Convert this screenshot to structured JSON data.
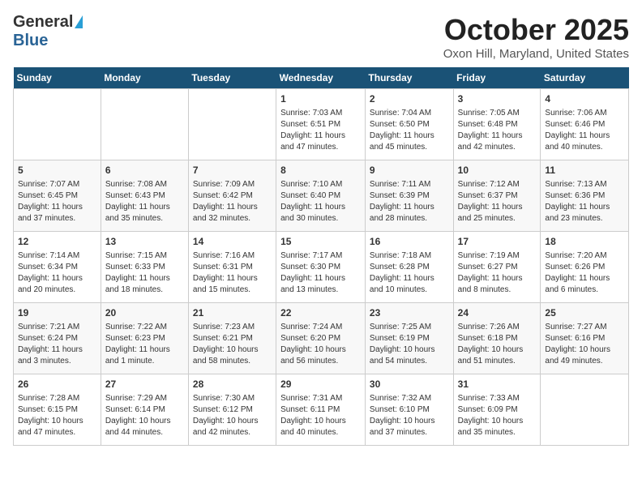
{
  "logo": {
    "general": "General",
    "blue": "Blue"
  },
  "title": "October 2025",
  "location": "Oxon Hill, Maryland, United States",
  "days_of_week": [
    "Sunday",
    "Monday",
    "Tuesday",
    "Wednesday",
    "Thursday",
    "Friday",
    "Saturday"
  ],
  "weeks": [
    [
      {
        "day": "",
        "info": ""
      },
      {
        "day": "",
        "info": ""
      },
      {
        "day": "",
        "info": ""
      },
      {
        "day": "1",
        "info": "Sunrise: 7:03 AM\nSunset: 6:51 PM\nDaylight: 11 hours\nand 47 minutes."
      },
      {
        "day": "2",
        "info": "Sunrise: 7:04 AM\nSunset: 6:50 PM\nDaylight: 11 hours\nand 45 minutes."
      },
      {
        "day": "3",
        "info": "Sunrise: 7:05 AM\nSunset: 6:48 PM\nDaylight: 11 hours\nand 42 minutes."
      },
      {
        "day": "4",
        "info": "Sunrise: 7:06 AM\nSunset: 6:46 PM\nDaylight: 11 hours\nand 40 minutes."
      }
    ],
    [
      {
        "day": "5",
        "info": "Sunrise: 7:07 AM\nSunset: 6:45 PM\nDaylight: 11 hours\nand 37 minutes."
      },
      {
        "day": "6",
        "info": "Sunrise: 7:08 AM\nSunset: 6:43 PM\nDaylight: 11 hours\nand 35 minutes."
      },
      {
        "day": "7",
        "info": "Sunrise: 7:09 AM\nSunset: 6:42 PM\nDaylight: 11 hours\nand 32 minutes."
      },
      {
        "day": "8",
        "info": "Sunrise: 7:10 AM\nSunset: 6:40 PM\nDaylight: 11 hours\nand 30 minutes."
      },
      {
        "day": "9",
        "info": "Sunrise: 7:11 AM\nSunset: 6:39 PM\nDaylight: 11 hours\nand 28 minutes."
      },
      {
        "day": "10",
        "info": "Sunrise: 7:12 AM\nSunset: 6:37 PM\nDaylight: 11 hours\nand 25 minutes."
      },
      {
        "day": "11",
        "info": "Sunrise: 7:13 AM\nSunset: 6:36 PM\nDaylight: 11 hours\nand 23 minutes."
      }
    ],
    [
      {
        "day": "12",
        "info": "Sunrise: 7:14 AM\nSunset: 6:34 PM\nDaylight: 11 hours\nand 20 minutes."
      },
      {
        "day": "13",
        "info": "Sunrise: 7:15 AM\nSunset: 6:33 PM\nDaylight: 11 hours\nand 18 minutes."
      },
      {
        "day": "14",
        "info": "Sunrise: 7:16 AM\nSunset: 6:31 PM\nDaylight: 11 hours\nand 15 minutes."
      },
      {
        "day": "15",
        "info": "Sunrise: 7:17 AM\nSunset: 6:30 PM\nDaylight: 11 hours\nand 13 minutes."
      },
      {
        "day": "16",
        "info": "Sunrise: 7:18 AM\nSunset: 6:28 PM\nDaylight: 11 hours\nand 10 minutes."
      },
      {
        "day": "17",
        "info": "Sunrise: 7:19 AM\nSunset: 6:27 PM\nDaylight: 11 hours\nand 8 minutes."
      },
      {
        "day": "18",
        "info": "Sunrise: 7:20 AM\nSunset: 6:26 PM\nDaylight: 11 hours\nand 6 minutes."
      }
    ],
    [
      {
        "day": "19",
        "info": "Sunrise: 7:21 AM\nSunset: 6:24 PM\nDaylight: 11 hours\nand 3 minutes."
      },
      {
        "day": "20",
        "info": "Sunrise: 7:22 AM\nSunset: 6:23 PM\nDaylight: 11 hours\nand 1 minute."
      },
      {
        "day": "21",
        "info": "Sunrise: 7:23 AM\nSunset: 6:21 PM\nDaylight: 10 hours\nand 58 minutes."
      },
      {
        "day": "22",
        "info": "Sunrise: 7:24 AM\nSunset: 6:20 PM\nDaylight: 10 hours\nand 56 minutes."
      },
      {
        "day": "23",
        "info": "Sunrise: 7:25 AM\nSunset: 6:19 PM\nDaylight: 10 hours\nand 54 minutes."
      },
      {
        "day": "24",
        "info": "Sunrise: 7:26 AM\nSunset: 6:18 PM\nDaylight: 10 hours\nand 51 minutes."
      },
      {
        "day": "25",
        "info": "Sunrise: 7:27 AM\nSunset: 6:16 PM\nDaylight: 10 hours\nand 49 minutes."
      }
    ],
    [
      {
        "day": "26",
        "info": "Sunrise: 7:28 AM\nSunset: 6:15 PM\nDaylight: 10 hours\nand 47 minutes."
      },
      {
        "day": "27",
        "info": "Sunrise: 7:29 AM\nSunset: 6:14 PM\nDaylight: 10 hours\nand 44 minutes."
      },
      {
        "day": "28",
        "info": "Sunrise: 7:30 AM\nSunset: 6:12 PM\nDaylight: 10 hours\nand 42 minutes."
      },
      {
        "day": "29",
        "info": "Sunrise: 7:31 AM\nSunset: 6:11 PM\nDaylight: 10 hours\nand 40 minutes."
      },
      {
        "day": "30",
        "info": "Sunrise: 7:32 AM\nSunset: 6:10 PM\nDaylight: 10 hours\nand 37 minutes."
      },
      {
        "day": "31",
        "info": "Sunrise: 7:33 AM\nSunset: 6:09 PM\nDaylight: 10 hours\nand 35 minutes."
      },
      {
        "day": "",
        "info": ""
      }
    ]
  ]
}
